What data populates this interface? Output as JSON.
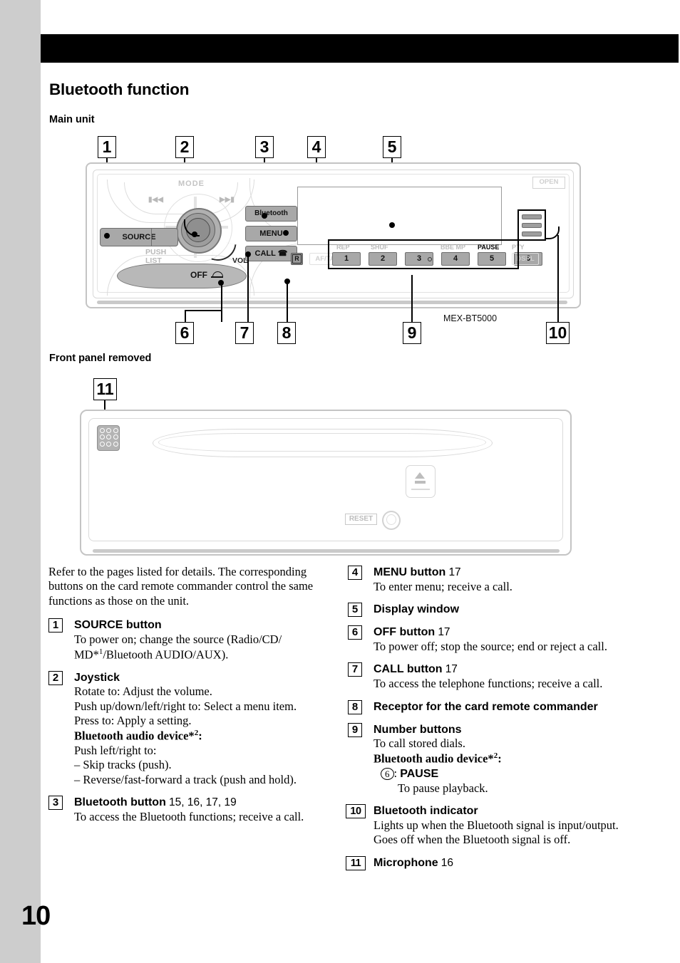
{
  "page": {
    "number": "10"
  },
  "heading": {
    "title": "Bluetooth function"
  },
  "sections": {
    "main_unit": "Main unit",
    "front_panel_removed": "Front panel removed"
  },
  "diagram_main": {
    "model": "MEX-BT5000",
    "callouts": [
      "1",
      "2",
      "3",
      "4",
      "5",
      "6",
      "7",
      "8",
      "9",
      "10"
    ],
    "controls": {
      "source": "SOURCE",
      "mode": "MODE",
      "prev": "▮◀◀",
      "next": "▶▶▮",
      "push": "PUSH",
      "list": "LIST",
      "vol": "VOL",
      "off": "OFF",
      "bluetooth": "Bluetooth",
      "menu": "MENU",
      "call": "CALL",
      "open": "OPEN",
      "af_ta": "AF/TA",
      "dspl": "DSPL",
      "r_button": "R"
    },
    "preset_labels": [
      "REP",
      "SHUF",
      "",
      "",
      "BBE MP",
      "PAUSE"
    ],
    "preset_buttons": [
      "1",
      "2",
      "3",
      "4",
      "5",
      "6"
    ],
    "pty": "PTY"
  },
  "diagram_sub": {
    "callouts": [
      "11"
    ],
    "reset": "RESET"
  },
  "intro": "Refer to the pages listed for details. The corresponding buttons on the card remote commander control the same functions as those on the unit.",
  "left_items": [
    {
      "num": "1",
      "title": "SOURCE button",
      "pages": "",
      "lines": [
        "To power on; change the source (Radio/CD/",
        "MD*¹/Bluetooth AUDIO/AUX)."
      ]
    },
    {
      "num": "2",
      "title": "Joystick",
      "pages": "",
      "lines": [
        "Rotate to: Adjust the volume.",
        "Push up/down/left/right to: Select a menu item.",
        "Press to: Apply a setting."
      ],
      "bold_line": "Bluetooth audio device*²:",
      "after_bold": [
        "Push left/right to:"
      ],
      "dashes": [
        "– Skip tracks (push).",
        "– Reverse/fast-forward a track (push and hold)."
      ]
    },
    {
      "num": "3",
      "title": "Bluetooth button",
      "pages": "15, 16, 17, 19",
      "lines": [
        "To access the Bluetooth functions; receive a call."
      ]
    }
  ],
  "right_items": [
    {
      "num": "4",
      "title": "MENU button",
      "pages": "17",
      "lines": [
        "To enter menu; receive a call."
      ]
    },
    {
      "num": "5",
      "title": "Display window",
      "pages": "",
      "lines": []
    },
    {
      "num": "6",
      "title": "OFF button",
      "pages": "17",
      "lines": [
        "To power off; stop the source; end or reject a call."
      ]
    },
    {
      "num": "7",
      "title": "CALL button",
      "pages": "17",
      "lines": [
        "To access the telephone functions; receive a call."
      ]
    },
    {
      "num": "8",
      "title": "Receptor for the card remote commander",
      "pages": "",
      "lines": []
    },
    {
      "num": "9",
      "title": "Number buttons",
      "pages": "",
      "lines": [
        "To call stored dials."
      ],
      "bold_line": "Bluetooth audio device*²:",
      "circle_label": "6",
      "circle_value": "PAUSE",
      "circle_desc": "To pause playback."
    },
    {
      "num": "10",
      "title": "Bluetooth indicator",
      "pages": "",
      "lines": [
        "Lights up when the Bluetooth signal is input/output. Goes off when the Bluetooth signal is off."
      ]
    },
    {
      "num": "11",
      "title": "Microphone",
      "pages": "16",
      "lines": []
    }
  ]
}
